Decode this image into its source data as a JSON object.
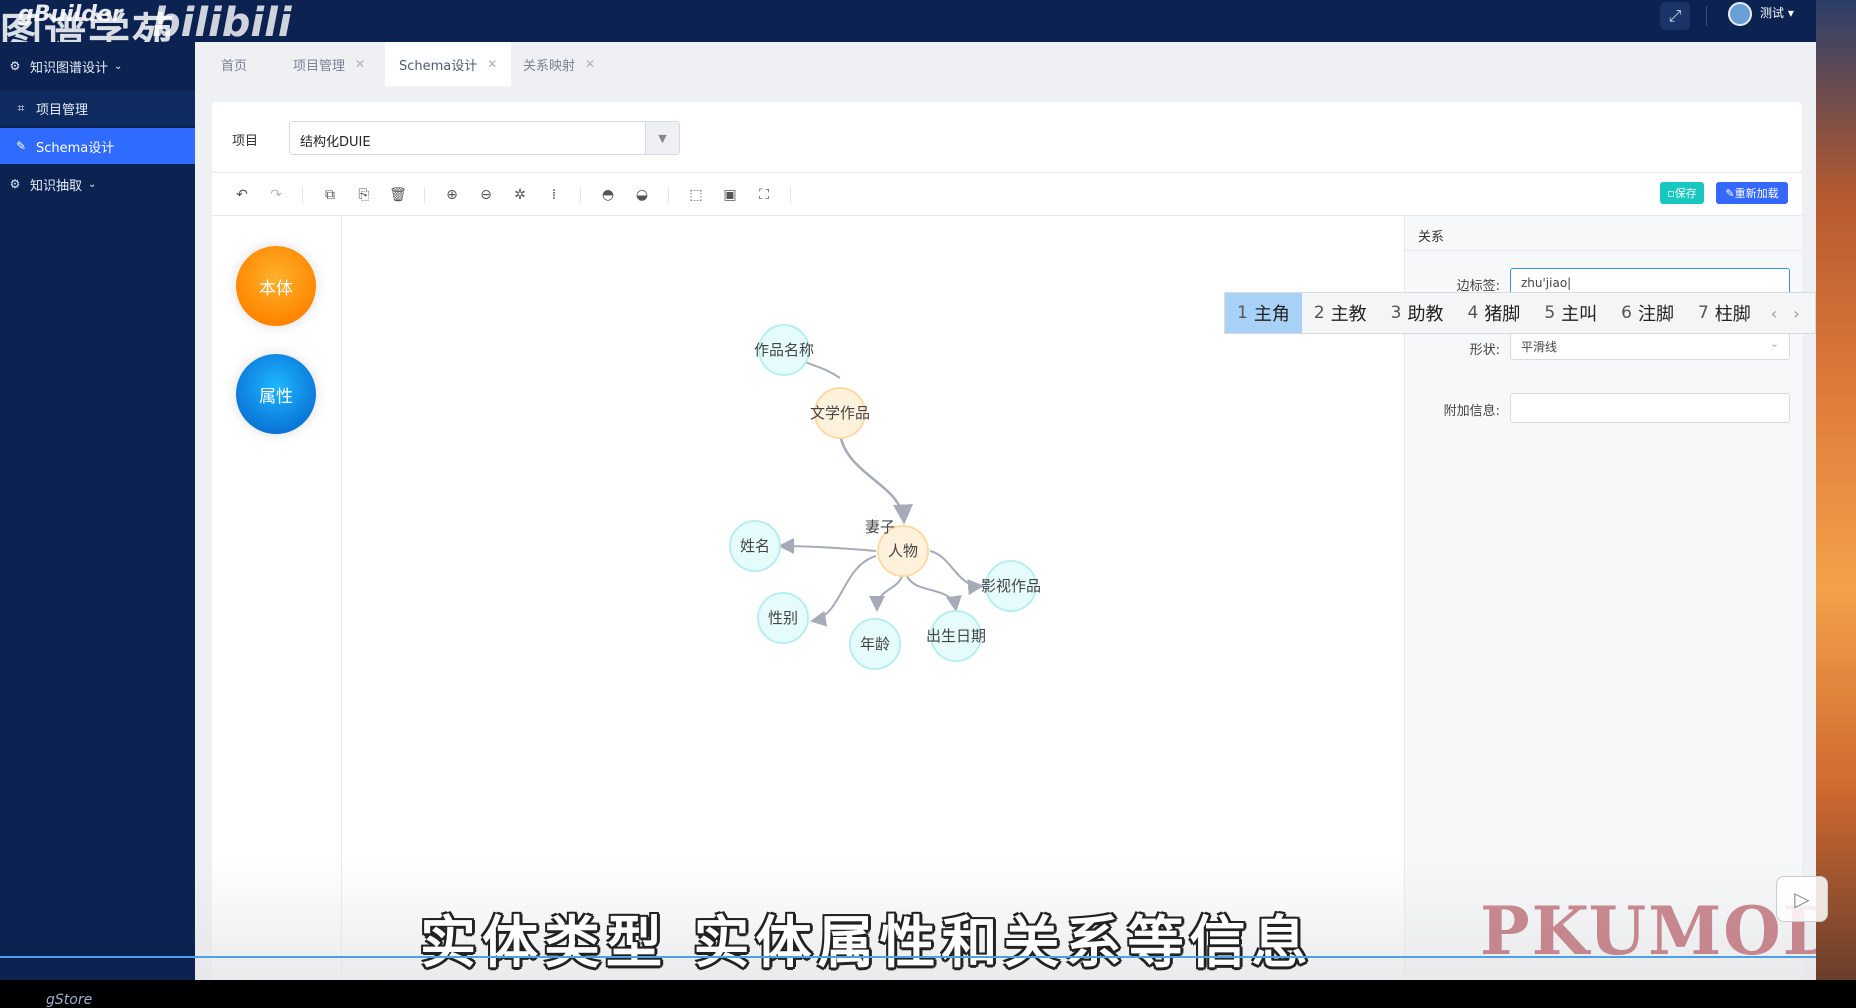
{
  "app": {
    "logo": "gBuilder",
    "watermark_cn": "图谱学苑",
    "watermark_site": "bilibili",
    "user": "测试"
  },
  "sidebar": {
    "items": [
      {
        "label": "知识图谱设计",
        "icon": "settings-icon",
        "expanded": true
      },
      {
        "label": "项目管理",
        "icon": "camera-icon"
      },
      {
        "label": "Schema设计",
        "icon": "tools-icon",
        "active": true
      },
      {
        "label": "知识抽取",
        "icon": "gear-icon",
        "expanded": false
      }
    ],
    "footer": "gStore"
  },
  "tabs": [
    {
      "label": "首页"
    },
    {
      "label": "项目管理"
    },
    {
      "label": "Schema设计",
      "active": true
    },
    {
      "label": "关系映射"
    }
  ],
  "project": {
    "label": "项目",
    "value": "结构化DUIE"
  },
  "toolbar": {
    "save": "保存",
    "reload": "重新加载"
  },
  "stencil": {
    "entity": "本体",
    "attribute": "属性"
  },
  "graph": {
    "nodes": [
      "作品名称",
      "文学作品",
      "人物",
      "姓名",
      "性别",
      "年龄",
      "出生日期",
      "影视作品"
    ],
    "edge_label": "妻子"
  },
  "props": {
    "title": "关系",
    "edge_label_field": "边标签:",
    "edge_label_value": "zhu'jiao",
    "shape_field": "形状:",
    "shape_value": "平滑线",
    "extra_field": "附加信息:",
    "extra_value": ""
  },
  "ime": {
    "candidates": [
      {
        "n": "1",
        "text": "主角"
      },
      {
        "n": "2",
        "text": "主教"
      },
      {
        "n": "3",
        "text": "助教"
      },
      {
        "n": "4",
        "text": "猪脚"
      },
      {
        "n": "5",
        "text": "主叫"
      },
      {
        "n": "6",
        "text": "注脚"
      },
      {
        "n": "7",
        "text": "柱脚"
      }
    ]
  },
  "overlay": {
    "subtitle": "实体类型  实体属性和关系等信息",
    "brand": "PKUMOD"
  },
  "colors": {
    "sidebar": "#0c2352",
    "active": "#2f6bff",
    "entity": "#ff8a00",
    "attribute": "#0a78d8",
    "node_entity": "#fff2dc",
    "node_attr": "#e6fbfb"
  }
}
